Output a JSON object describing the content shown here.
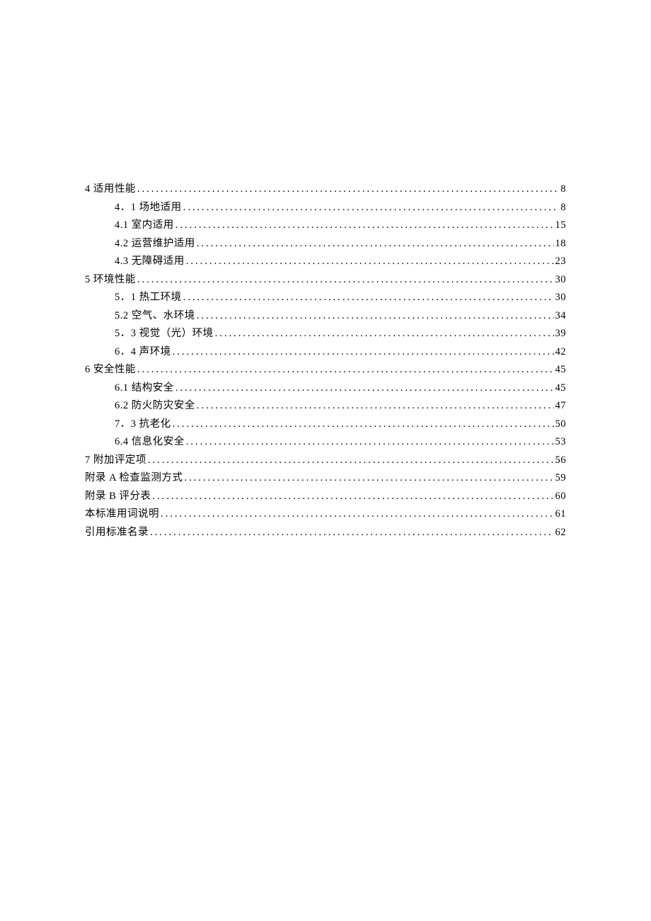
{
  "toc": [
    {
      "level": 0,
      "label": "4 适用性能",
      "page": "8"
    },
    {
      "level": 1,
      "label": "4．1 场地适用",
      "page": "8"
    },
    {
      "level": 1,
      "label": "4.1  室内适用",
      "page": "15"
    },
    {
      "level": 1,
      "label": "4.2  运营维护适用",
      "page": "18"
    },
    {
      "level": 1,
      "label": "4.3  无障碍适用",
      "page": "23"
    },
    {
      "level": 0,
      "label": "5 环境性能 ",
      "page": "30"
    },
    {
      "level": 1,
      "label": "5．1 热工环境",
      "page": "30"
    },
    {
      "level": 1,
      "label": "5.2  空气、水环境",
      "page": "34"
    },
    {
      "level": 1,
      "label": "5．3 视觉（光）环境 ",
      "page": "39"
    },
    {
      "level": 1,
      "label": "6．4 声环境",
      "page": "42"
    },
    {
      "level": 0,
      "label": "6 安全性能 ",
      "page": "45"
    },
    {
      "level": 1,
      "label": "6.1  结构安全",
      "page": "45"
    },
    {
      "level": 1,
      "label": "6.2  防火防灾安全",
      "page": "47"
    },
    {
      "level": 1,
      "label": "7．3 抗老化 ",
      "page": "50"
    },
    {
      "level": 1,
      "label": "6.4 信息化安全 ",
      "page": "53"
    },
    {
      "level": 0,
      "label": "7 附加评定项 ",
      "page": "56"
    },
    {
      "level": 0,
      "label": "附录 A 检查监测方式",
      "page": "59"
    },
    {
      "level": 0,
      "label": "附录 B 评分表",
      "page": "60"
    },
    {
      "level": 0,
      "label": "本标准用词说明 ",
      "page": "61"
    },
    {
      "level": 0,
      "label": "引用标准名录 ",
      "page": "62"
    }
  ]
}
